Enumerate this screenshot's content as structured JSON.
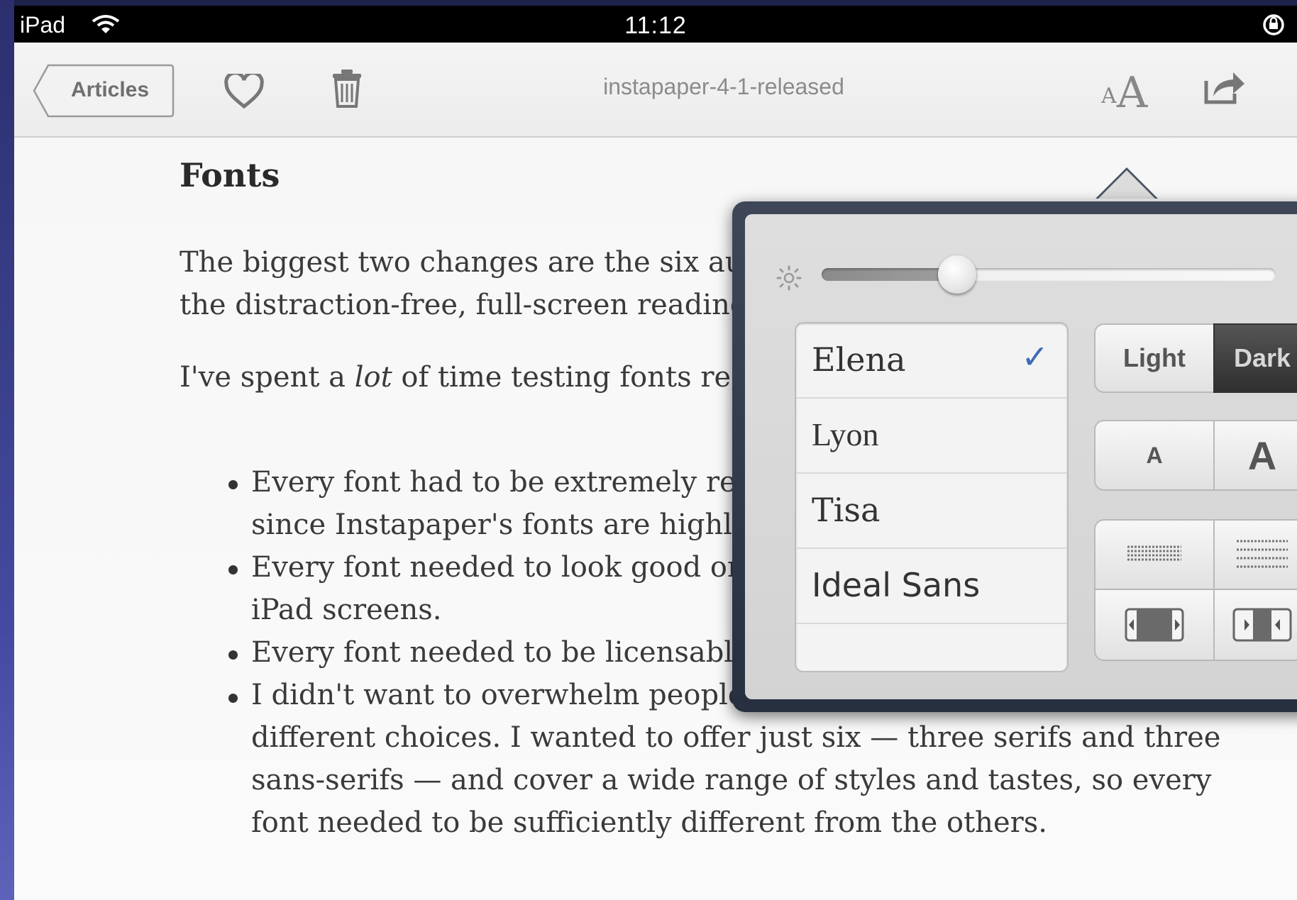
{
  "status_bar": {
    "device": "iPad",
    "time": "11:12"
  },
  "toolbar": {
    "back_label": "Articles",
    "title": "instapaper-4-1-released",
    "font_toggle_small": "A",
    "font_toggle_big": "A"
  },
  "article": {
    "heading": "Fonts",
    "para1_line1": "The biggest two changes are the six au",
    "para1_line2": "the distraction-free, full-screen reading",
    "para2_prefix": "I've spent a ",
    "para2_em": "lot",
    "para2_suffix": " of time testing fonts rec",
    "bullets": [
      {
        "line1": "Every font had to be extremely rea",
        "line2": "since Instapaper's fonts are highly"
      },
      {
        "line1": "Every font needed to look good or",
        "line2": "iPad screens."
      },
      {
        "line1": "Every font needed to be licensable for apps. (Easier said than done.)"
      },
      {
        "line1": "I didn't want to overwhelm people with a barrage of slightly",
        "line2": "different choices. I wanted to offer just six — three serifs and three",
        "line3": "sans-serifs — and cover a wide range of styles and tastes, so every",
        "line4": "font needed to be sufficiently different from the others."
      }
    ]
  },
  "popover": {
    "brightness_level": 0.27,
    "fonts": [
      {
        "name": "Elena",
        "selected": true
      },
      {
        "name": "Lyon"
      },
      {
        "name": "Tisa"
      },
      {
        "name": "Ideal Sans"
      }
    ],
    "theme": {
      "light": "Light",
      "dark": "Dark",
      "selected": "Dark"
    },
    "size": {
      "smaller": "A",
      "larger": "A"
    }
  }
}
